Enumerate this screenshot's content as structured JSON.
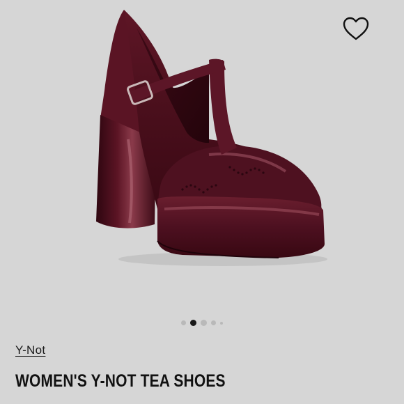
{
  "product": {
    "brand": "Y-Not",
    "title": "WOMEN'S Y-NOT TEA SHOES"
  },
  "carousel": {
    "total": 5,
    "active_index": 1
  },
  "colors": {
    "background": "#d6d6d6",
    "shoe": "#4a0f1c",
    "active_dot": "#1a1a1a",
    "inactive_dot": "#b9b9b9"
  },
  "icons": {
    "favorite": "heart-outline-icon"
  }
}
